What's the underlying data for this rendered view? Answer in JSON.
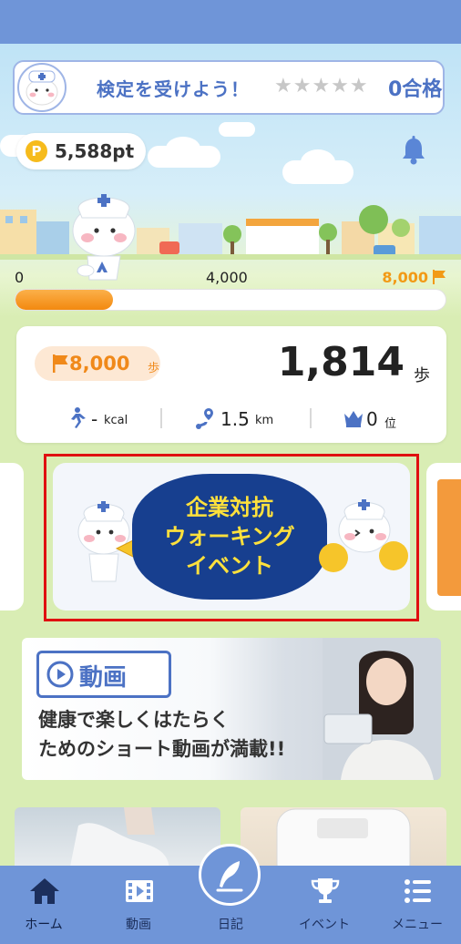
{
  "skill_test": {
    "title": "検定を受けよう！",
    "stars": "★★★★★",
    "passed": "0合格"
  },
  "points": {
    "coin_label": "P",
    "value": "5,588pt"
  },
  "progress": {
    "start_label": "0",
    "mid_label": "4,000",
    "goal_label": "8,000",
    "fraction": 0.2268
  },
  "steps_card": {
    "goal_value": "8,000",
    "goal_unit": "歩",
    "steps_value": "1,814",
    "steps_unit": "歩",
    "calories_value": "-",
    "calories_unit": "kcal",
    "distance_value": "1.5",
    "distance_unit": "km",
    "rank_value": "0",
    "rank_unit": "位"
  },
  "event_banner": {
    "title_line1": "企業対抗",
    "title_line2": "ウォーキング",
    "title_line3": "イベント"
  },
  "video_banner": {
    "badge_label": "動画",
    "text_line1": "健康で楽しくはたらく",
    "text_line2": "ためのショート動画が満載!!"
  },
  "bottom_nav": {
    "items": [
      {
        "label": "ホーム",
        "icon": "home-icon"
      },
      {
        "label": "動画",
        "icon": "film-icon"
      },
      {
        "label": "日記",
        "icon": "pen-icon"
      },
      {
        "label": "イベント",
        "icon": "trophy-icon"
      },
      {
        "label": "メニュー",
        "icon": "menu-icon"
      }
    ]
  },
  "colors": {
    "nav_blue": "#6f95d8",
    "accent_orange": "#f29a16",
    "text_blue": "#4c72c4",
    "background_green": "#d9edb4"
  }
}
